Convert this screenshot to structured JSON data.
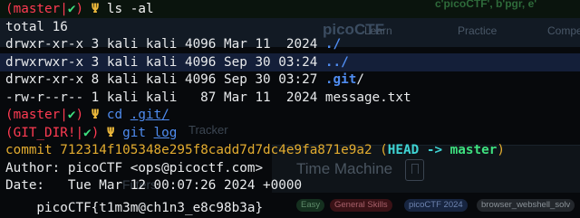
{
  "background_page": {
    "top_fragment": "c'picoCTF', b'pgr, e'",
    "logo": "picoCTF",
    "nav_items": [
      "Learn",
      "Practice",
      "Compete"
    ],
    "tracker_text": "Tracker",
    "card_title": "Time Machine",
    "filters_label": "Filters",
    "tags": [
      "Easy",
      "General Skills",
      "picoCTF 2024",
      "browser_webshell_solv"
    ]
  },
  "terminal": {
    "prompt_branch_1": "master",
    "prompt_mark_1": "✔",
    "prompt_trident": "Ψ",
    "cmd_1": "ls -al",
    "total": "total 16",
    "entries": [
      {
        "meta": "drwxr-xr-x 3 kali kali 4096 Mar 11  2024 ",
        "name": "./",
        "kind": "dir"
      },
      {
        "meta": "drwxrwxr-x 3 kali kali 4096 Sep 30 03:24 ",
        "name": "../",
        "kind": "dir"
      },
      {
        "meta": "drwxr-xr-x 8 kali kali 4096 Sep 30 03:27 ",
        "name": ".git",
        "suffix": "/",
        "kind": "dir"
      },
      {
        "meta": "-rw-r--r-- 1 kali kali   87 Mar 11  2024 ",
        "name": "message.txt",
        "kind": "file"
      }
    ],
    "prompt_branch_2": "master",
    "prompt_mark_2": "✔",
    "cmd_2_word": "cd",
    "cmd_2_arg": ".git/",
    "prompt_gitdir": "GIT_DIR!",
    "prompt_mark_3": "✔",
    "cmd_3_word": "git",
    "cmd_3_arg": "log",
    "commit_label": "commit ",
    "commit_hash": "712314f105348e295f8cadd7d7dc4e9fa871e9a2",
    "commit_head": "HEAD",
    "commit_arrow": " -> ",
    "commit_branch": "master",
    "author": "Author: picoCTF <ops@picoctf.com>",
    "date": "Date:   Tue Mar 12 00:07:26 2024 +0000",
    "message": "    picoCTF{t1m3m@ch1n3_e8c98b3a}"
  },
  "colors": {
    "background": "#07090c",
    "prompt_red": "#ff3b52",
    "check_green": "#3ee07f",
    "trident_yellow": "#eab63a",
    "dir_blue": "#4f8cf0",
    "commit_yellow": "#e3ac2f",
    "head_cyan": "#3fd4d4"
  }
}
